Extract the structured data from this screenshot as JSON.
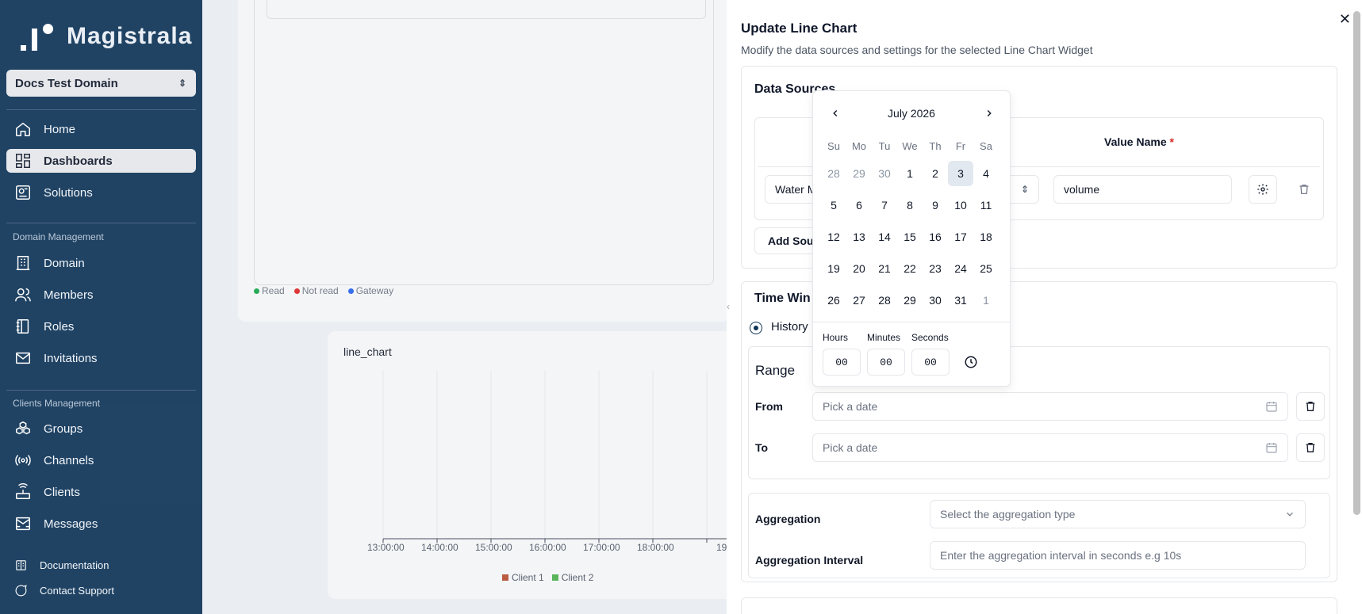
{
  "sidebar": {
    "logo_text": "Magistrala",
    "domain": "Docs Test Domain",
    "items": [
      {
        "label": "Home"
      },
      {
        "label": "Dashboards"
      },
      {
        "label": "Solutions"
      }
    ],
    "domain_section": "Domain Management",
    "domain_items": [
      {
        "label": "Domain"
      },
      {
        "label": "Members"
      },
      {
        "label": "Roles"
      },
      {
        "label": "Invitations"
      }
    ],
    "clients_section": "Clients Management",
    "clients_items": [
      {
        "label": "Groups"
      },
      {
        "label": "Channels"
      },
      {
        "label": "Clients"
      },
      {
        "label": "Messages"
      }
    ],
    "footer": [
      {
        "label": "Documentation"
      },
      {
        "label": "Contact Support"
      }
    ]
  },
  "background": {
    "legend_top": [
      "Read",
      "Not read",
      "Gateway"
    ],
    "legend_top_colors": [
      "#16a34a",
      "#dc2626",
      "#2563eb"
    ],
    "chart_title": "line_chart",
    "x_ticks": [
      "13:00:00",
      "14:00:00",
      "15:00:00",
      "16:00:00",
      "17:00:00",
      "18:00:00",
      "19"
    ],
    "legend_chart": [
      "Client 1",
      "Client 2"
    ],
    "legend_chart_colors": [
      "#b45032",
      "#4caf50"
    ]
  },
  "dialog": {
    "title": "Update Line Chart",
    "description": "Modify the data sources and settings for the selected Line Chart Widget",
    "data_sources_title": "Data Sources",
    "value_name_header": "Value Name",
    "required_mark": "*",
    "source_value": "Water M",
    "value_name_value": "volume",
    "add_source_label": "Add Sou",
    "time_window_title": "Time Win",
    "history_label": "History",
    "range_label": "Range",
    "from_label": "From",
    "to_label": "To",
    "from_placeholder": "Pick a date",
    "to_placeholder": "Pick a date",
    "aggregation_label": "Aggregation",
    "aggregation_placeholder": "Select the aggregation type",
    "aggregation_interval_label": "Aggregation Interval",
    "aggregation_interval_placeholder": "Enter the aggregation interval in seconds e.g 10s"
  },
  "picker": {
    "month": "July 2026",
    "weekdays": [
      "Su",
      "Mo",
      "Tu",
      "We",
      "Th",
      "Fr",
      "Sa"
    ],
    "weeks": [
      [
        "28",
        "29",
        "30",
        "1",
        "2",
        "3",
        "4"
      ],
      [
        "5",
        "6",
        "7",
        "8",
        "9",
        "10",
        "11"
      ],
      [
        "12",
        "13",
        "14",
        "15",
        "16",
        "17",
        "18"
      ],
      [
        "19",
        "20",
        "21",
        "22",
        "23",
        "24",
        "25"
      ],
      [
        "26",
        "27",
        "28",
        "29",
        "30",
        "31",
        "1"
      ]
    ],
    "hours_label": "Hours",
    "minutes_label": "Minutes",
    "seconds_label": "Seconds",
    "hours": "00",
    "minutes": "00",
    "seconds": "00"
  }
}
